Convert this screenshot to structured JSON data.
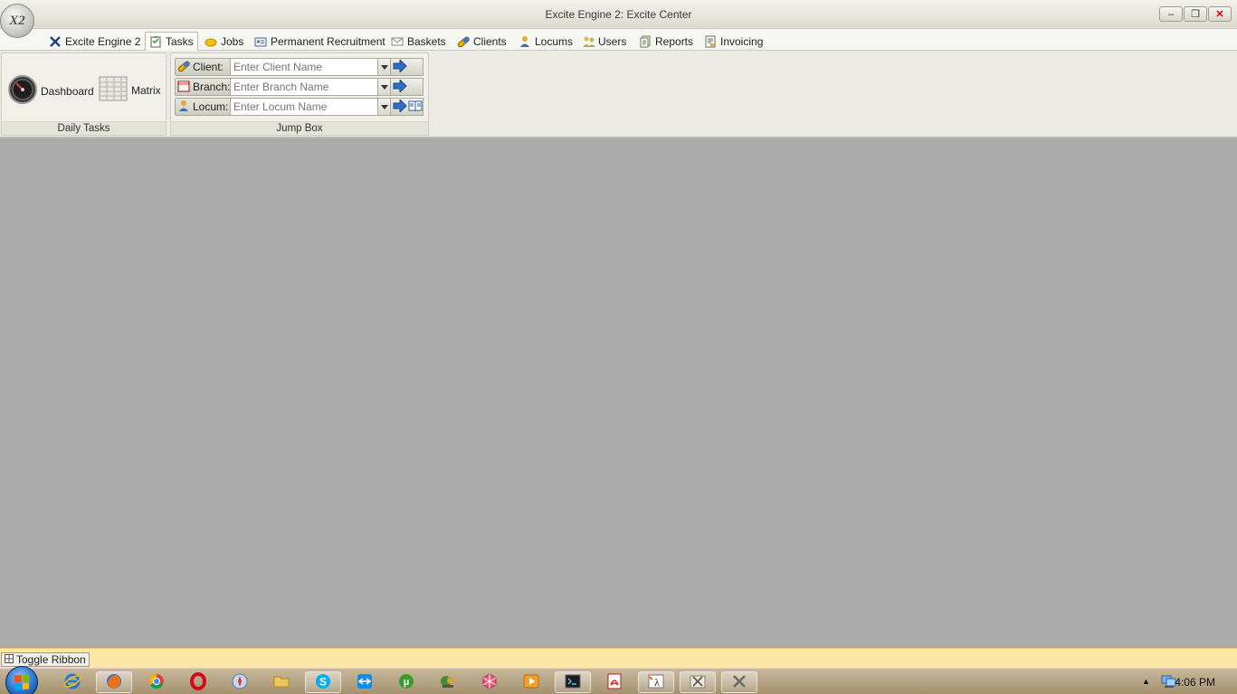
{
  "window": {
    "title": "Excite Engine 2: Excite Center",
    "orb_label": "X2",
    "buttons": {
      "minimize": "–",
      "restore": "❐",
      "close": "✕"
    }
  },
  "tabs": [
    {
      "label": "Excite Engine 2",
      "icon": "x2-icon"
    },
    {
      "label": "Tasks",
      "icon": "clipboard-icon",
      "active": true
    },
    {
      "label": "Jobs",
      "icon": "hard-hat-icon"
    },
    {
      "label": "Permanent Recruitment",
      "icon": "id-card-icon"
    },
    {
      "label": "Baskets",
      "icon": "envelope-icon"
    },
    {
      "label": "Clients",
      "icon": "pill-icon"
    },
    {
      "label": "Locums",
      "icon": "person-icon"
    },
    {
      "label": "Users",
      "icon": "users-icon"
    },
    {
      "label": "Reports",
      "icon": "report-icon"
    },
    {
      "label": "Invoicing",
      "icon": "invoice-icon"
    }
  ],
  "ribbon": {
    "daily_tasks": {
      "label": "Daily Tasks",
      "dashboard": "Dashboard",
      "matrix": "Matrix"
    },
    "jump_box": {
      "label": "Jump Box",
      "client": {
        "label": "Client:",
        "placeholder": "Enter Client Name"
      },
      "branch": {
        "label": "Branch:",
        "placeholder": "Enter Branch Name"
      },
      "locum": {
        "label": "Locum:",
        "placeholder": "Enter Locum Name"
      }
    }
  },
  "statusbar": {
    "toggle_ribbon": "Toggle Ribbon"
  },
  "taskbar": {
    "clock": "4:06 PM",
    "tray_arrow": "▲"
  },
  "colors": {
    "workspace": "#ababab",
    "statusbar": "#fde7a6",
    "ribbon": "#ebebe3"
  }
}
